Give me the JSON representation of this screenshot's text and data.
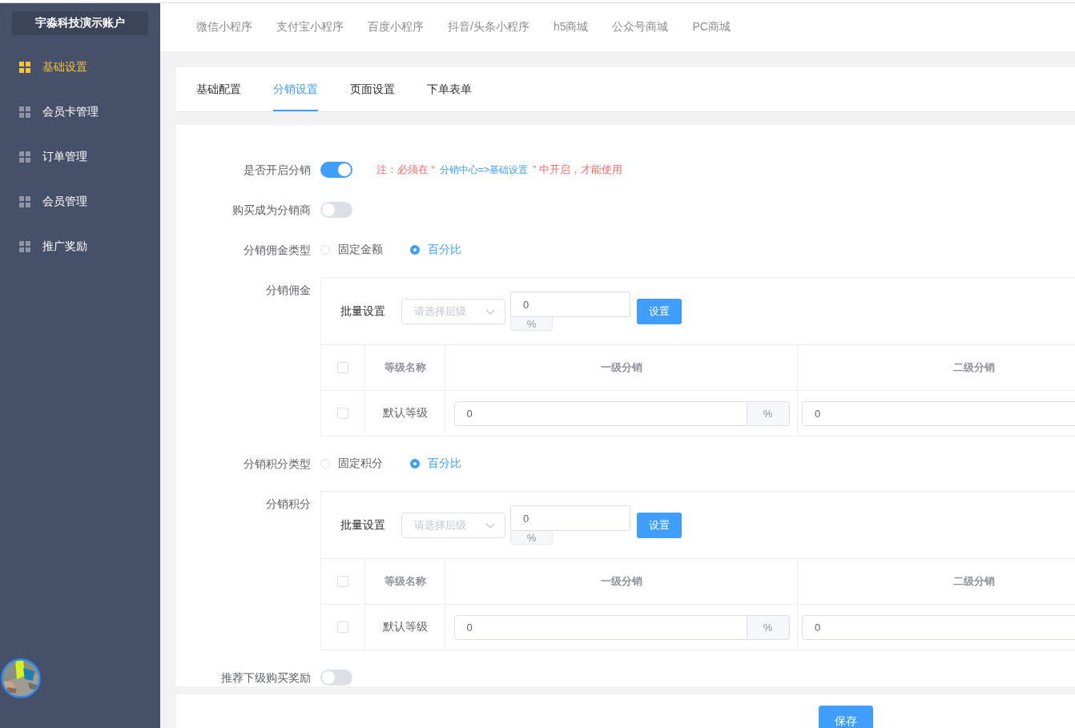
{
  "sidebar": {
    "account": "宇淼科技演示账户",
    "items": [
      {
        "label": "基础设置",
        "selected": true
      },
      {
        "label": "会员卡管理",
        "selected": false
      },
      {
        "label": "订单管理",
        "selected": false
      },
      {
        "label": "会员管理",
        "selected": false
      },
      {
        "label": "推广奖励",
        "selected": false
      }
    ]
  },
  "top_nav": {
    "items": [
      "微信小程序",
      "支付宝小程序",
      "百度小程序",
      "抖音/头条小程序",
      "h5商城",
      "公众号商城",
      "PC商城"
    ]
  },
  "tabs": [
    {
      "label": "基础配置",
      "selected": false
    },
    {
      "label": "分销设置",
      "selected": true
    },
    {
      "label": "页面设置",
      "selected": false
    },
    {
      "label": "下单表单",
      "selected": false
    }
  ],
  "form_rows": [
    {
      "kind": "toggle",
      "label": "是否开启分销",
      "on": true,
      "note": [
        {
          "kind": "plain",
          "text": "注：必须在 “"
        },
        {
          "kind": "link",
          "text": "分销中心=>基础设置"
        },
        {
          "kind": "plain",
          "text": "” 中开启，才能使用"
        }
      ]
    },
    {
      "kind": "toggle",
      "label": "购买成为分销商",
      "on": false
    },
    {
      "kind": "radio",
      "label": "分销佣金类型",
      "options": [
        {
          "label": "固定金额",
          "selected": false
        },
        {
          "label": "百分比",
          "selected": true
        }
      ]
    },
    {
      "kind": "table",
      "label": "分销佣金",
      "batch": {
        "label": "批量设置",
        "select_placeholder": "请选择层级",
        "value": "0",
        "unit": "%",
        "button": "设置"
      },
      "header_checked": false,
      "columns": [
        "等级名称",
        "一级分销",
        "二级分销"
      ],
      "rows": [
        {
          "checked": false,
          "name": "默认等级",
          "level_1": "0",
          "level_1_unit": "%",
          "level_2": "0"
        }
      ]
    },
    {
      "kind": "radio",
      "label": "分销积分类型",
      "options": [
        {
          "label": "固定积分",
          "selected": false
        },
        {
          "label": "百分比",
          "selected": true
        }
      ]
    },
    {
      "kind": "table",
      "label": "分销积分",
      "batch": {
        "label": "批量设置",
        "select_placeholder": "请选择层级",
        "value": "0",
        "unit": "%",
        "button": "设置"
      },
      "header_checked": false,
      "columns": [
        "等级名称",
        "一级分销",
        "二级分销"
      ],
      "rows": [
        {
          "checked": false,
          "name": "默认等级",
          "level_1": "0",
          "level_1_unit": "%",
          "level_2": "0"
        }
      ]
    },
    {
      "kind": "toggle",
      "label": "推荐下级购买奖励",
      "on": false
    }
  ],
  "save_button": "保存"
}
